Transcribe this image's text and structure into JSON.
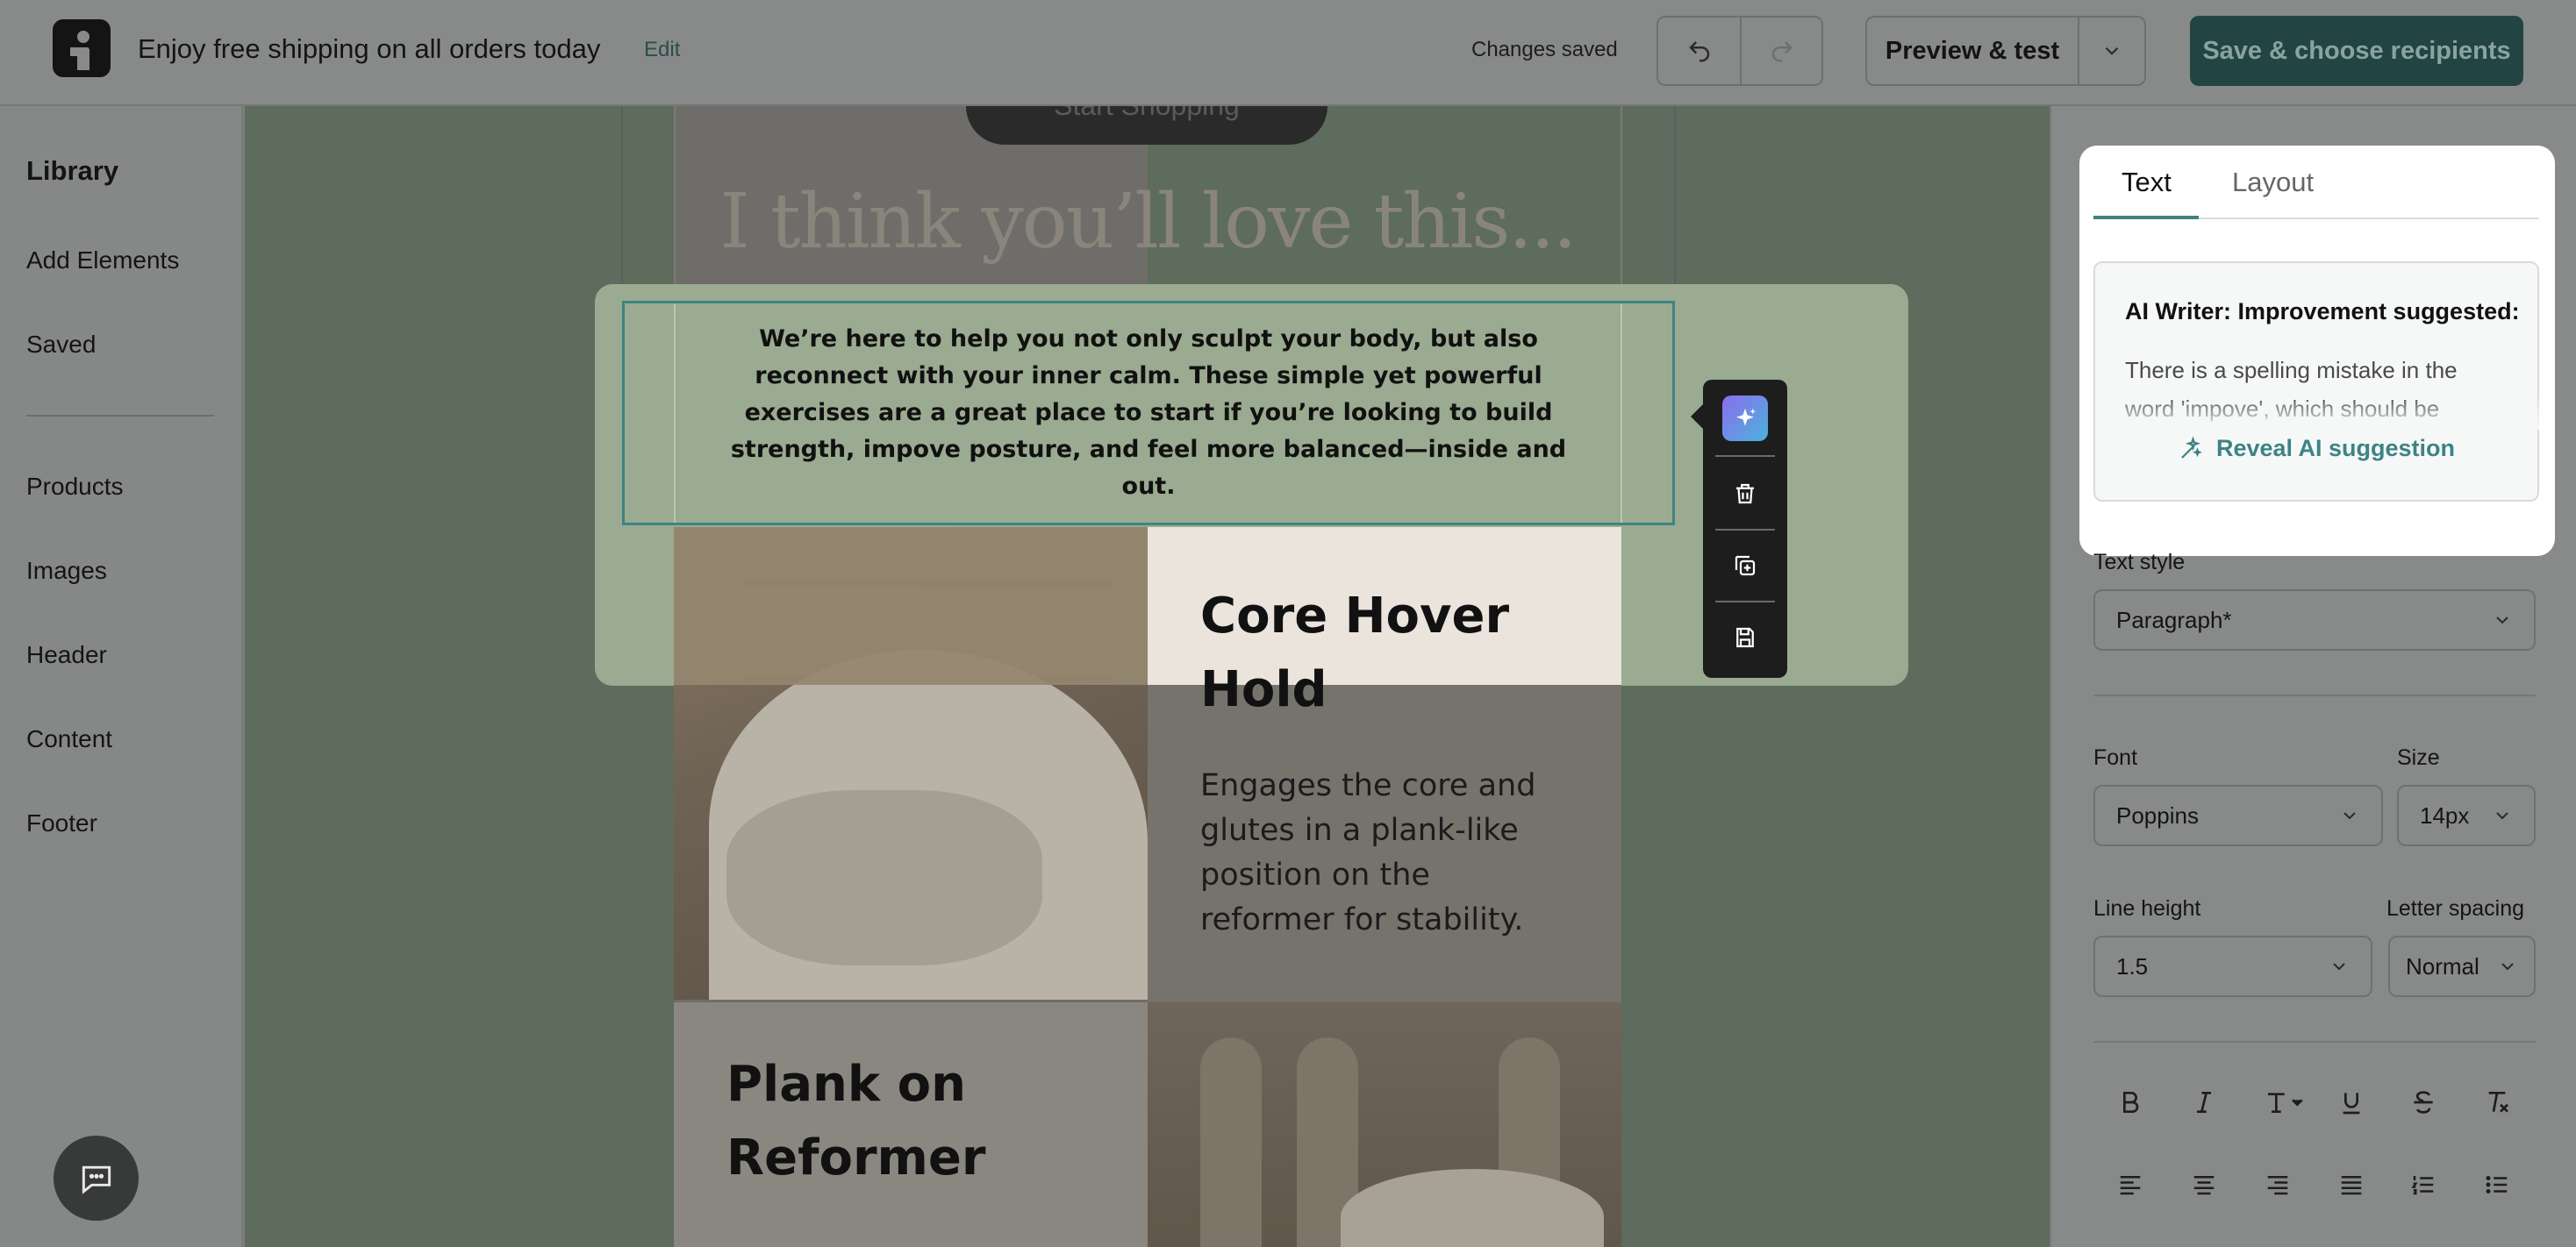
{
  "header": {
    "email_title": "Enjoy free shipping on all orders today",
    "edit_label": "Edit",
    "status": "Changes saved",
    "preview_label": "Preview & test",
    "save_label": "Save & choose recipients"
  },
  "sidebar": {
    "title": "Library",
    "items_top": [
      "Add Elements",
      "Saved"
    ],
    "items_bottom": [
      "Products",
      "Images",
      "Header",
      "Content",
      "Footer"
    ]
  },
  "canvas": {
    "cta_label": "Start Shopping",
    "headline": "I think you’ll love this...",
    "selected_paragraph": "We’re here to help you not only sculpt your body, but also reconnect with your inner calm. These simple yet powerful exercises are a great place to start if you’re looking to build strength, impove posture, and feel more balanced—inside and out.",
    "exercise1_title": "Core Hover Hold",
    "exercise1_desc": "Engages the core and glutes in a plank-like position on the reformer for stability.",
    "exercise2_title": "Plank on Reformer"
  },
  "panel": {
    "tabs": [
      "Text",
      "Layout"
    ],
    "ai_title": "AI Writer: Improvement suggested:",
    "ai_body": "There is a spelling mistake in the word 'impove', which should be",
    "ai_reveal": "Reveal AI suggestion",
    "text_style_label": "Text style",
    "text_style_value": "Paragraph*",
    "font_label": "Font",
    "font_value": "Poppins",
    "size_label": "Size",
    "size_value": "14px",
    "line_height_label": "Line height",
    "line_height_value": "1.5",
    "letter_spacing_label": "Letter spacing",
    "letter_spacing_value": "Normal"
  },
  "colors": {
    "accent": "#3e8383",
    "primary_button": "#224543",
    "highlight": "#9aab91"
  }
}
